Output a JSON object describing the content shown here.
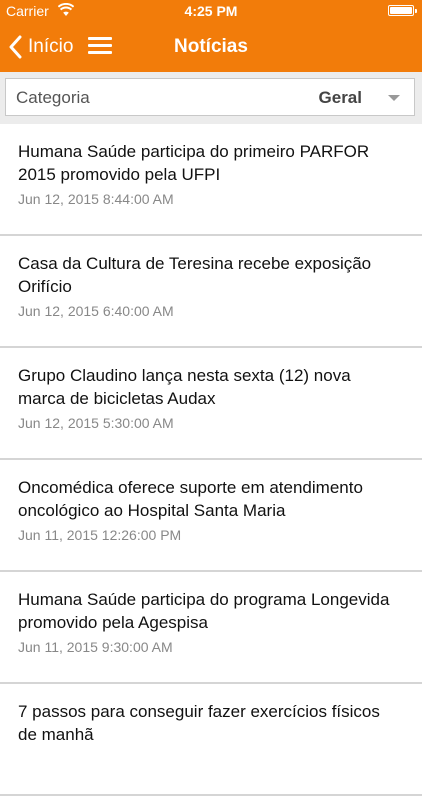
{
  "status_bar": {
    "carrier": "Carrier",
    "time": "4:25 PM",
    "wifi_icon": "wifi-icon",
    "battery_icon": "battery-icon"
  },
  "nav": {
    "back_label": "Início",
    "back_icon": "chevron-left-icon",
    "menu_icon": "hamburger-menu-icon",
    "title": "Notícias"
  },
  "category": {
    "label": "Categoria",
    "value": "Geral",
    "caret_icon": "caret-down-icon"
  },
  "news": [
    {
      "headline": "Humana Saúde participa do primeiro PARFOR 2015 promovido pela UFPI",
      "date": "Jun 12, 2015 8:44:00 AM"
    },
    {
      "headline": "Casa da Cultura de Teresina recebe exposição Orifício",
      "date": "Jun 12, 2015 6:40:00 AM"
    },
    {
      "headline": "Grupo Claudino lança nesta sexta (12) nova marca de bicicletas Audax",
      "date": "Jun 12, 2015 5:30:00 AM"
    },
    {
      "headline": "Oncomédica oferece suporte em atendimento oncológico ao Hospital Santa Maria",
      "date": "Jun 11, 2015 12:26:00 PM"
    },
    {
      "headline": "Humana Saúde participa do programa Longevida promovido pela Agespisa",
      "date": "Jun 11, 2015 9:30:00 AM"
    },
    {
      "headline": "7 passos para conseguir fazer exercícios físicos de manhã",
      "date": ""
    }
  ],
  "colors": {
    "accent": "#f27c0a",
    "category_bar": "#ececec",
    "date_text": "#888888",
    "divider": "#d5d5d5"
  }
}
